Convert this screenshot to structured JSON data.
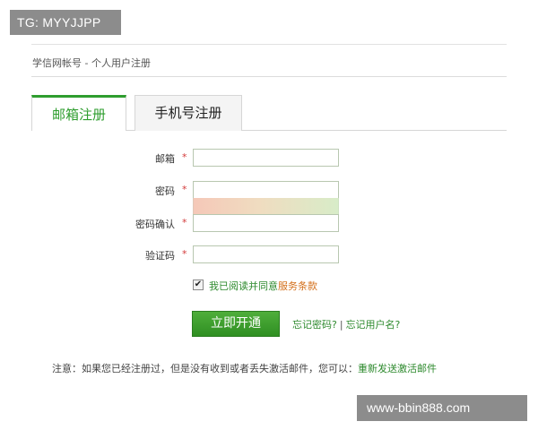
{
  "watermarks": {
    "top": "TG: MYYJJPP",
    "bottom": "www-bbin888.com"
  },
  "page": {
    "title": "学信网帐号 - 个人用户注册"
  },
  "tabs": [
    {
      "label": "邮箱注册",
      "active": true
    },
    {
      "label": "手机号注册",
      "active": false
    }
  ],
  "form": {
    "required_mark": "*",
    "email": {
      "label": "邮箱",
      "value": ""
    },
    "password": {
      "label": "密码",
      "value": ""
    },
    "confirm": {
      "label": "密码确认",
      "value": ""
    },
    "captcha": {
      "label": "验证码",
      "value": ""
    },
    "agreement": {
      "checked": true,
      "check_glyph": "✔",
      "text": "我已阅读并同意",
      "link": "服务条款"
    },
    "submit_label": "立即开通",
    "forgot_password": "忘记密码?",
    "separator": "|",
    "forgot_username": "忘记用户名?"
  },
  "notice": {
    "text": "注意：如果您已经注册过，但是没有收到或者丢失激活邮件，您可以：",
    "link": "重新发送激活邮件"
  },
  "colors": {
    "accent_green": "#2e9d2e",
    "link_orange": "#d4701c",
    "required_red": "#d33a3a"
  }
}
